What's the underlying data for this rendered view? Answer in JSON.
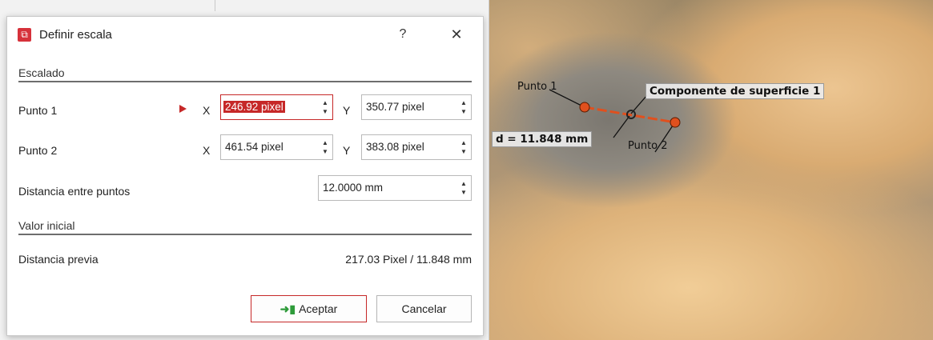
{
  "dialog": {
    "title": "Definir escala",
    "help_label": "?",
    "close_label": "✕"
  },
  "section_scaling": {
    "label": "Escalado",
    "point1": {
      "label": "Punto 1",
      "x_axis": "X",
      "x_value": "246.92 pixel",
      "y_axis": "Y",
      "y_value": "350.77 pixel"
    },
    "point2": {
      "label": "Punto 2",
      "x_axis": "X",
      "x_value": "461.54 pixel",
      "y_axis": "Y",
      "y_value": "383.08 pixel"
    },
    "distance": {
      "label": "Distancia entre puntos",
      "value": "12.0000 mm"
    }
  },
  "section_initial": {
    "label": "Valor inicial",
    "previous": {
      "label": "Distancia previa",
      "value": "217.03 Pixel / 11.848 mm"
    }
  },
  "buttons": {
    "accept": "Aceptar",
    "cancel": "Cancelar"
  },
  "viewer": {
    "point1_label": "Punto 1",
    "point2_label": "Punto 2",
    "component_label": "Componente de superficie 1",
    "distance_label": "d = 11.848 mm",
    "marker_color": "#e0501e"
  }
}
